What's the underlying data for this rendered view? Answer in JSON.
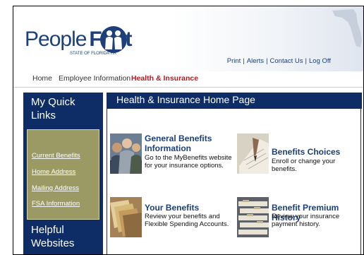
{
  "header": {
    "brand_light": "People",
    "brand_bold": "First",
    "brand_tagline": "STATE OF FLORIDA HR",
    "links": [
      "Print",
      "Alerts",
      "Contact Us",
      "Log Off"
    ],
    "link_separator": "|"
  },
  "nav": {
    "items": [
      "Home",
      "Employee Information",
      "Health & Insurance"
    ],
    "active": "Health & Insurance"
  },
  "sidebar": {
    "quick_links_title_line1": "My Quick",
    "quick_links_title_line2": "Links",
    "quick_links": [
      "Current Benefits",
      "Home Address",
      "Mailing Address",
      "FSA Information"
    ],
    "helpful_title_line1": "Helpful",
    "helpful_title_line2": "Websites"
  },
  "main": {
    "title": "Health & Insurance Home Page",
    "items": [
      {
        "title_line1": "General Benefits",
        "title_line2": "Information",
        "desc_line1": "Go to the MyBenefits website",
        "desc_line2": "for your insurance options."
      },
      {
        "title_line1": "Benefits Choices",
        "desc_line1": "Enroll or change your benefits."
      },
      {
        "title_line1": "Your Benefits",
        "desc_line1": "Review your benefits and",
        "desc_line2": "Flexible Spending Accounts."
      },
      {
        "title_line1": "Benefit Premium History",
        "desc_line1": "Review your insurance",
        "desc_line2": "payment history."
      }
    ]
  },
  "colors": {
    "navy": "#0e2c66",
    "brand_blue": "#1d3f7a",
    "active_red": "#c0161c",
    "olive": "#9c9a64"
  }
}
